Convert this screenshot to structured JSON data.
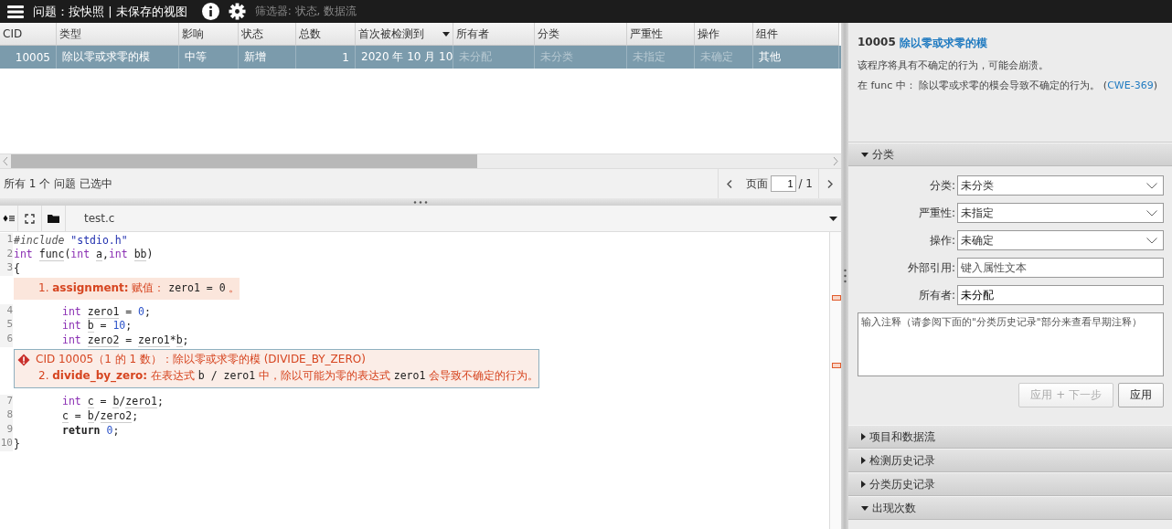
{
  "top_bar": {
    "title": "问题：按快照 | 未保存的视图",
    "filter": "筛选器: 状态, 数据流"
  },
  "table": {
    "columns": [
      {
        "label": "CID",
        "kind": "number",
        "sorted": false
      },
      {
        "label": "类型",
        "kind": "text",
        "sorted": false
      },
      {
        "label": "影响",
        "kind": "text",
        "sorted": false
      },
      {
        "label": "状态",
        "kind": "text",
        "sorted": false
      },
      {
        "label": "总数",
        "kind": "number",
        "sorted": false
      },
      {
        "label": "首次被检测到",
        "kind": "text",
        "sorted": true
      },
      {
        "label": "所有者",
        "kind": "text",
        "sorted": false
      },
      {
        "label": "分类",
        "kind": "text",
        "sorted": false
      },
      {
        "label": "严重性",
        "kind": "text",
        "sorted": false
      },
      {
        "label": "操作",
        "kind": "text",
        "sorted": false
      },
      {
        "label": "组件",
        "kind": "text",
        "sorted": false
      }
    ],
    "rows": [
      {
        "selected": true,
        "cells": [
          {
            "text": "10005",
            "muted": false
          },
          {
            "text": "除以零或求零的模",
            "muted": false
          },
          {
            "text": "中等",
            "muted": false
          },
          {
            "text": "新增",
            "muted": false
          },
          {
            "text": "1",
            "muted": false
          },
          {
            "text": "2020 年 10 月 10",
            "muted": false
          },
          {
            "text": "未分配",
            "muted": true
          },
          {
            "text": "未分类",
            "muted": true
          },
          {
            "text": "未指定",
            "muted": true
          },
          {
            "text": "未确定",
            "muted": true
          },
          {
            "text": "其他",
            "muted": false
          }
        ]
      }
    ]
  },
  "status": "所有 1 个 问题 已选中",
  "pager": {
    "label": "页面",
    "page": "1",
    "total": "/ 1"
  },
  "editor": {
    "file_tab": "test.c",
    "lines": [
      {
        "kind": "code",
        "number": "1",
        "indented": false,
        "tokens": [
          {
            "kind": "pp",
            "t": "#include "
          },
          {
            "kind": "str",
            "t": "\"stdio.h\""
          }
        ]
      },
      {
        "kind": "code",
        "number": "2",
        "indented": false,
        "tokens": [
          {
            "kind": "kw",
            "t": "int "
          },
          {
            "kind": "id",
            "t": "func"
          },
          {
            "kind": "plain",
            "t": "("
          },
          {
            "kind": "kw",
            "t": "int "
          },
          {
            "kind": "id",
            "t": "a"
          },
          {
            "kind": "plain",
            "t": ","
          },
          {
            "kind": "kw",
            "t": "int "
          },
          {
            "kind": "id",
            "t": "bb"
          },
          {
            "kind": "plain",
            "t": ")"
          }
        ]
      },
      {
        "kind": "code",
        "number": "3",
        "indented": false,
        "tokens": [
          {
            "kind": "plain",
            "t": "{"
          }
        ]
      },
      {
        "kind": "event",
        "parts": [
          {
            "kind": "plain",
            "t": "1. "
          },
          {
            "kind": "bold",
            "t": "assignment:"
          },
          {
            "kind": "plain",
            "t": " 赋值： "
          },
          {
            "kind": "code",
            "t": "zero1 = 0"
          },
          {
            "kind": "plain",
            "t": " 。"
          }
        ]
      },
      {
        "kind": "code",
        "number": "4",
        "indented": true,
        "tokens": [
          {
            "kind": "kw",
            "t": "int "
          },
          {
            "kind": "id",
            "t": "zero1"
          },
          {
            "kind": "plain",
            "t": " = "
          },
          {
            "kind": "num",
            "t": "0"
          },
          {
            "kind": "plain",
            "t": ";"
          }
        ]
      },
      {
        "kind": "code",
        "number": "5",
        "indented": true,
        "tokens": [
          {
            "kind": "kw",
            "t": "int "
          },
          {
            "kind": "id",
            "t": "b"
          },
          {
            "kind": "plain",
            "t": " = "
          },
          {
            "kind": "num",
            "t": "10"
          },
          {
            "kind": "plain",
            "t": ";"
          }
        ]
      },
      {
        "kind": "code",
        "number": "6",
        "indented": true,
        "tokens": [
          {
            "kind": "kw",
            "t": "int "
          },
          {
            "kind": "id",
            "t": "zero2"
          },
          {
            "kind": "plain",
            "t": " = "
          },
          {
            "kind": "id",
            "t": "zero1"
          },
          {
            "kind": "plain",
            "t": "*"
          },
          {
            "kind": "id",
            "t": "b"
          },
          {
            "kind": "plain",
            "t": ";"
          }
        ]
      },
      {
        "kind": "defect",
        "title": "CID 10005（1 的 1 数）：除以零或求零的模 (DIVIDE_BY_ZERO)",
        "parts": [
          {
            "kind": "plain",
            "t": "2. "
          },
          {
            "kind": "bold",
            "t": "divide_by_zero:"
          },
          {
            "kind": "plain",
            "t": " 在表达式 "
          },
          {
            "kind": "code",
            "t": "b / zero1"
          },
          {
            "kind": "plain",
            "t": " 中，除以可能为零的表达式 "
          },
          {
            "kind": "code",
            "t": "zero1"
          },
          {
            "kind": "plain",
            "t": " 会导致不确定的行为。"
          }
        ]
      },
      {
        "kind": "code",
        "number": "7",
        "indented": true,
        "tokens": [
          {
            "kind": "kw",
            "t": "int "
          },
          {
            "kind": "id",
            "t": "c"
          },
          {
            "kind": "plain",
            "t": " = "
          },
          {
            "kind": "id",
            "t": "b"
          },
          {
            "kind": "plain",
            "t": "/"
          },
          {
            "kind": "id",
            "t": "zero1"
          },
          {
            "kind": "plain",
            "t": ";"
          }
        ]
      },
      {
        "kind": "code",
        "number": "8",
        "indented": true,
        "tokens": [
          {
            "kind": "id",
            "t": "c"
          },
          {
            "kind": "plain",
            "t": " = "
          },
          {
            "kind": "id",
            "t": "b"
          },
          {
            "kind": "plain",
            "t": "/"
          },
          {
            "kind": "id",
            "t": "zero2"
          },
          {
            "kind": "plain",
            "t": ";"
          }
        ]
      },
      {
        "kind": "code",
        "number": "9",
        "indented": true,
        "tokens": [
          {
            "kind": "ret",
            "t": "return "
          },
          {
            "kind": "num",
            "t": "0"
          },
          {
            "kind": "plain",
            "t": ";"
          }
        ]
      },
      {
        "kind": "code",
        "number": "10",
        "indented": false,
        "tokens": [
          {
            "kind": "plain",
            "t": "}"
          }
        ]
      }
    ]
  },
  "detail": {
    "cid": "10005",
    "title": "除以零或求零的模",
    "description": "该程序将具有不确定的行为，可能会崩溃。",
    "text_before": "在 func 中： 除以零或求零的模会导致不确定的行为。 (",
    "link": "CWE-369",
    "text_after": ")"
  },
  "triage": {
    "title": "分类",
    "expanded": true,
    "fields": [
      {
        "label": "分类:",
        "kind": "select",
        "value": "未分类"
      },
      {
        "label": "严重性:",
        "kind": "select",
        "value": "未指定"
      },
      {
        "label": "操作:",
        "kind": "select",
        "value": "未确定"
      },
      {
        "label": "外部引用:",
        "kind": "text",
        "placeholder": "键入属性文本"
      },
      {
        "label": "所有者:",
        "kind": "text",
        "value": "未分配"
      }
    ],
    "comment_placeholder": "输入注释（请参阅下面的\"分类历史记录\"部分来查看早期注释）",
    "buttons": [
      {
        "label": "应用 + 下一步",
        "disabled": true
      },
      {
        "label": "应用",
        "disabled": false
      }
    ]
  },
  "sections": [
    {
      "title": "项目和数据流",
      "expanded": false
    },
    {
      "title": "检测历史记录",
      "expanded": false
    },
    {
      "title": "分类历史记录",
      "expanded": false
    },
    {
      "title": "出现次数",
      "expanded": true
    }
  ]
}
